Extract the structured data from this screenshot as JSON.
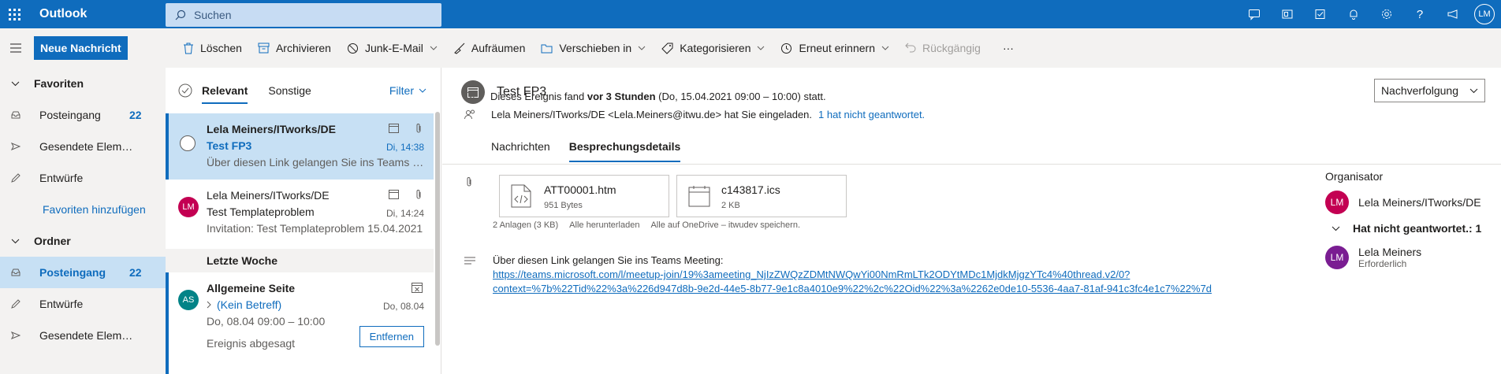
{
  "app": {
    "name": "Outlook",
    "user_initials": "LM"
  },
  "search": {
    "placeholder": "Suchen"
  },
  "toolbar": {
    "new_message": "Neue Nachricht",
    "delete": "Löschen",
    "archive": "Archivieren",
    "junk": "Junk-E-Mail",
    "sweep": "Aufräumen",
    "move": "Verschieben in",
    "categorize": "Kategorisieren",
    "snooze": "Erneut erinnern",
    "undo": "Rückgängig",
    "more": "···"
  },
  "nav": {
    "favorites": "Favoriten",
    "fav_items": [
      {
        "label": "Posteingang",
        "count": "22"
      },
      {
        "label": "Gesendete Elemente"
      },
      {
        "label": "Entwürfe"
      }
    ],
    "add_favorite": "Favoriten hinzufügen",
    "folders": "Ordner",
    "folder_items": [
      {
        "label": "Posteingang",
        "count": "22"
      },
      {
        "label": "Entwürfe"
      },
      {
        "label": "Gesendete Elemente"
      }
    ]
  },
  "list": {
    "tab_focused": "Relevant",
    "tab_other": "Sonstige",
    "filter": "Filter",
    "section_last_week": "Letzte Woche",
    "messages": [
      {
        "from": "Lela Meiners/ITworks/DE",
        "subject": "Test FP3",
        "time": "Di, 14:38",
        "preview": "Über diesen Link gelangen Sie ins Teams Meeting"
      },
      {
        "initials": "LM",
        "from": "Lela Meiners/ITworks/DE",
        "subject": "Test Templateproblem",
        "time": "Di, 14:24",
        "preview": "Invitation: Test Templateproblem 15.04.2021"
      },
      {
        "initials": "AS",
        "from": "Allgemeine Seite",
        "subject": "(Kein Betreff)",
        "time": "Do, 08.04",
        "preview": "Do, 08.04 09:00 – 10:00",
        "status": "Ereignis abgesagt",
        "action": "Entfernen"
      }
    ]
  },
  "reading": {
    "title": "Test FP3",
    "follow_up": "Nachverfolgung",
    "event_pre": "Dieses Ereignis fand ",
    "event_bold": "vor 3 Stunden",
    "event_post": " (Do, 15.04.2021 09:00 – 10:00) statt.",
    "invite_text": "Lela Meiners/ITworks/DE <Lela.Meiners@itwu.de> hat Sie eingeladen.",
    "invite_link": "1 hat nicht geantwortet.",
    "tab_messages": "Nachrichten",
    "tab_details": "Besprechungsdetails",
    "attachments": [
      {
        "name": "ATT00001.htm",
        "size": "951 Bytes",
        "icon": "code-file-icon"
      },
      {
        "name": "c143817.ics",
        "size": "2 KB",
        "icon": "calendar-file-icon"
      }
    ],
    "att_summary": "2 Anlagen (3 KB)",
    "download_all": "Alle herunterladen",
    "save_onedrive": "Alle auf OneDrive – itwudev speichern.",
    "body_text": "Über diesen Link gelangen Sie ins Teams Meeting:",
    "body_link_1": "https://teams.microsoft.com/l/meetup-join/19%3ameeting_NjIzZWQzZDMtNWQwYi00NmRmLTk2ODYtMDc1MjdkMjgzYTc4%40thread.v2/0?",
    "body_link_2": "context=%7b%22Tid%22%3a%226d947d8b-9e2d-44e5-8b77-9e1c8a4010e9%22%2c%22Oid%22%3a%2262e0de10-5536-4aa7-81af-941c3fc4e1c7%22%7d",
    "organizer_label": "Organisator",
    "organizer": {
      "initials": "LM",
      "name": "Lela Meiners/ITworks/DE"
    },
    "not_responded": "Hat nicht geantwortet.: 1",
    "attendee": {
      "initials": "LM",
      "name": "Lela Meiners",
      "role": "Erforderlich"
    }
  },
  "colors": {
    "brand": "#0f6cbd",
    "avatar_pink": "#c30052",
    "avatar_teal": "#038387",
    "avatar_purple": "#7a1d92"
  }
}
